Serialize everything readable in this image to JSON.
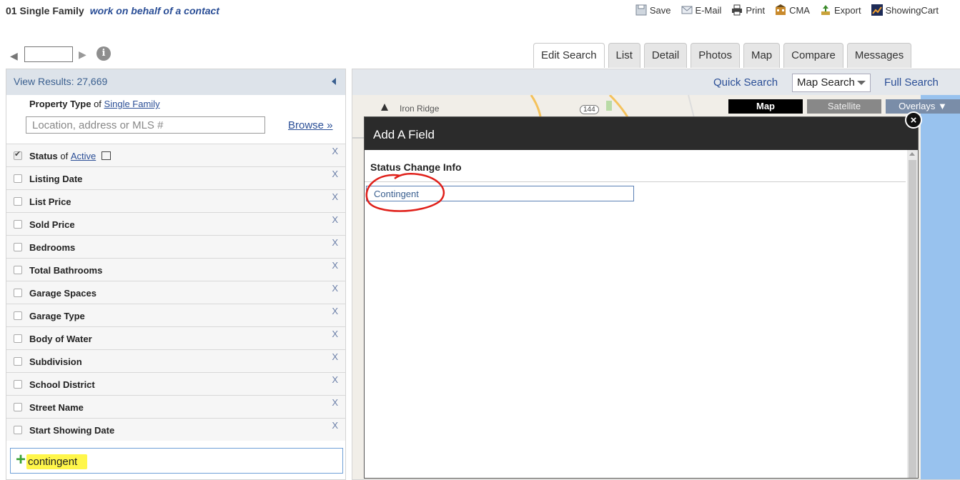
{
  "header": {
    "title": "01 Single Family",
    "subtitle": "work on behalf of a contact"
  },
  "toolbar": {
    "items": [
      {
        "label": "Save",
        "icon": "save-icon"
      },
      {
        "label": "E-Mail",
        "icon": "email-icon"
      },
      {
        "label": "Print",
        "icon": "print-icon"
      },
      {
        "label": "CMA",
        "icon": "cma-icon"
      },
      {
        "label": "Export",
        "icon": "export-icon"
      },
      {
        "label": "ShowingCart",
        "icon": "showingcart-icon"
      }
    ]
  },
  "tabs": [
    {
      "label": "Edit Search",
      "active": true
    },
    {
      "label": "List",
      "active": false
    },
    {
      "label": "Detail",
      "active": false
    },
    {
      "label": "Photos",
      "active": false
    },
    {
      "label": "Map",
      "active": false
    },
    {
      "label": "Compare",
      "active": false
    },
    {
      "label": "Messages",
      "active": false
    }
  ],
  "left_panel": {
    "results_label": "View Results: 27,669",
    "property_type_label": "Property Type",
    "property_type_of": "of",
    "property_type_value": "Single Family",
    "location_placeholder": "Location, address or MLS #",
    "browse_label": "Browse »",
    "fields": [
      {
        "label": "Status",
        "checked": true,
        "of": "of",
        "value": "Active",
        "calendar": true
      },
      {
        "label": "Listing Date",
        "checked": false
      },
      {
        "label": "List Price",
        "checked": false
      },
      {
        "label": "Sold Price",
        "checked": false
      },
      {
        "label": "Bedrooms",
        "checked": false
      },
      {
        "label": "Total Bathrooms",
        "checked": false
      },
      {
        "label": "Garage Spaces",
        "checked": false
      },
      {
        "label": "Garage Type",
        "checked": false
      },
      {
        "label": "Body of Water",
        "checked": false
      },
      {
        "label": "Subdivision",
        "checked": false
      },
      {
        "label": "School District",
        "checked": false
      },
      {
        "label": "Street Name",
        "checked": false
      },
      {
        "label": "Start Showing Date",
        "checked": false
      }
    ],
    "remove_label": "X",
    "add_field_value": "contingent"
  },
  "right_panel": {
    "quick_search": "Quick Search",
    "map_search": "Map Search",
    "full_search": "Full Search",
    "map_buttons": {
      "map": "Map",
      "satellite": "Satellite",
      "overlays": "Overlays ▼"
    },
    "map_labels": {
      "place": "Iron Ridge",
      "road": "144"
    }
  },
  "modal": {
    "title": "Add A Field",
    "section_heading": "Status Change Info",
    "option": "Contingent",
    "close_glyph": "×"
  },
  "colors": {
    "header_dark": "#2b2b2b",
    "link_blue": "#2a4e96",
    "highlight_yellow": "#fff64a",
    "annotation_red": "#e0201a",
    "water_blue": "#98c2ee"
  }
}
